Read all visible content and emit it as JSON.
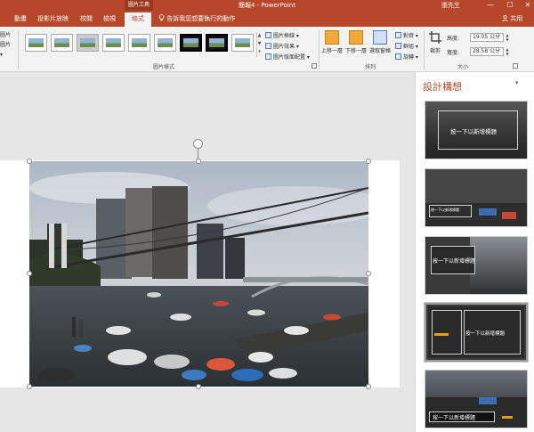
{
  "app": {
    "title": "簡報4 - PowerPoint",
    "tool_tab_header": "圖片工具",
    "user": "張先生",
    "window_buttons": [
      "—",
      "☐",
      "✕"
    ]
  },
  "tabs": {
    "items": [
      "動畫",
      "投影片放映",
      "校閱",
      "檢視",
      "格式"
    ],
    "active": "格式",
    "tell_me": "告訴我您想要執行的動作",
    "share": "共用"
  },
  "ribbon": {
    "left_cut": [
      "圖片",
      "圖片",
      "▾"
    ],
    "picture_styles": {
      "label": "圖片樣式",
      "commands": [
        "圖片框線 ▾",
        "圖片效果 ▾",
        "圖片版面配置 ▾"
      ]
    },
    "arrange": {
      "label": "排列",
      "bring_forward": "上移一層",
      "send_backward": "下移一層",
      "selection_pane": "選取窗格",
      "align": "對齊 ▾",
      "group": "群組 ▾",
      "rotate": "旋轉 ▾"
    },
    "size": {
      "label": "大小",
      "crop": "裁剪",
      "height_label": "高度:",
      "height_value": "19.05 公分",
      "width_label": "寬度:",
      "width_value": "28.58 公分"
    }
  },
  "design_pane": {
    "title": "設計構想",
    "menu": "▾",
    "close": "✕",
    "placeholder": "按一下以新增標題",
    "selected_index": 3
  },
  "colors": {
    "accent": "#b7472a",
    "ribbon_bg": "#f3f3f3",
    "canvas_bg": "#e6e6e6"
  },
  "icons": [
    "lightbulb-icon",
    "person-icon",
    "rotate-icon",
    "crop-icon",
    "align-icon",
    "group-icon",
    "rotate-object-icon"
  ]
}
